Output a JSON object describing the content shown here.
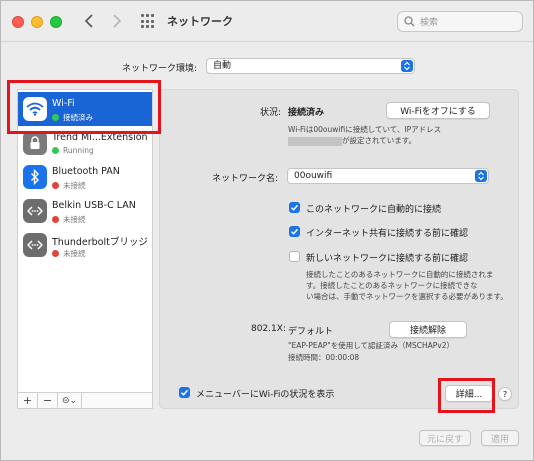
{
  "toolbar": {
    "title": "ネットワーク",
    "search_placeholder": "検索"
  },
  "location": {
    "label": "ネットワーク環境:",
    "value": "自動"
  },
  "sidebar": {
    "items": [
      {
        "name": "Wi-Fi",
        "status": "接続済み",
        "status_color": "#34c759",
        "icon": "wifi-icon"
      },
      {
        "name": "Trend Mi...Extension",
        "status": "Running",
        "status_color": "#34c759",
        "icon": "lock-icon"
      },
      {
        "name": "Bluetooth PAN",
        "status": "未接続",
        "status_color": "#e0443e",
        "icon": "bluetooth-icon"
      },
      {
        "name": "Belkin USB-C LAN",
        "status": "未接続",
        "status_color": "#e0443e",
        "icon": "ethernet-icon"
      },
      {
        "name": "Thunderboltブリッジ",
        "status": "未接続",
        "status_color": "#e0443e",
        "icon": "ethernet-icon"
      }
    ],
    "footer": {
      "add": "+",
      "remove": "−",
      "action": "⊝⌄"
    }
  },
  "main": {
    "status_label": "状況:",
    "status_value": "接続済み",
    "wifi_off_button": "Wi-Fiをオフにする",
    "status_detail_line1": "Wi-Fiは00ouwifiに接続していて、IPアドレス",
    "status_detail_line2": "が設定されています。",
    "network_name_label": "ネットワーク名:",
    "network_name_value": "00ouwifi",
    "checkboxes": [
      {
        "label": "このネットワークに自動的に接続",
        "checked": true
      },
      {
        "label": "インターネット共有に接続する前に確認",
        "checked": true
      },
      {
        "label": "新しいネットワークに接続する前に確認",
        "checked": false
      }
    ],
    "ask_note_line1": "接続したことのあるネットワークに自動的に接続されま",
    "ask_note_line2": "す。接続したことのあるネットワークに接続できな",
    "ask_note_line3": "い場合は、手動でネットワークを選択する必要があります。",
    "dot1x_label": "802.1X:",
    "dot1x_value": "デフォルト",
    "disconnect_button": "接続解除",
    "auth_line": "\"EAP-PEAP\"を使用して認証済み（MSCHAPv2）",
    "connect_time": "接続時間：00:00:08",
    "menubar_checkbox": "メニューバーにWi-Fiの状況を表示",
    "menubar_checked": true,
    "advanced_button": "詳細...",
    "help": "?"
  },
  "bottom": {
    "revert": "元に戻す",
    "apply": "適用"
  },
  "colors": {
    "accent": "#1a73e8",
    "selection": "#1a65d6",
    "highlight": "#e3141b"
  }
}
